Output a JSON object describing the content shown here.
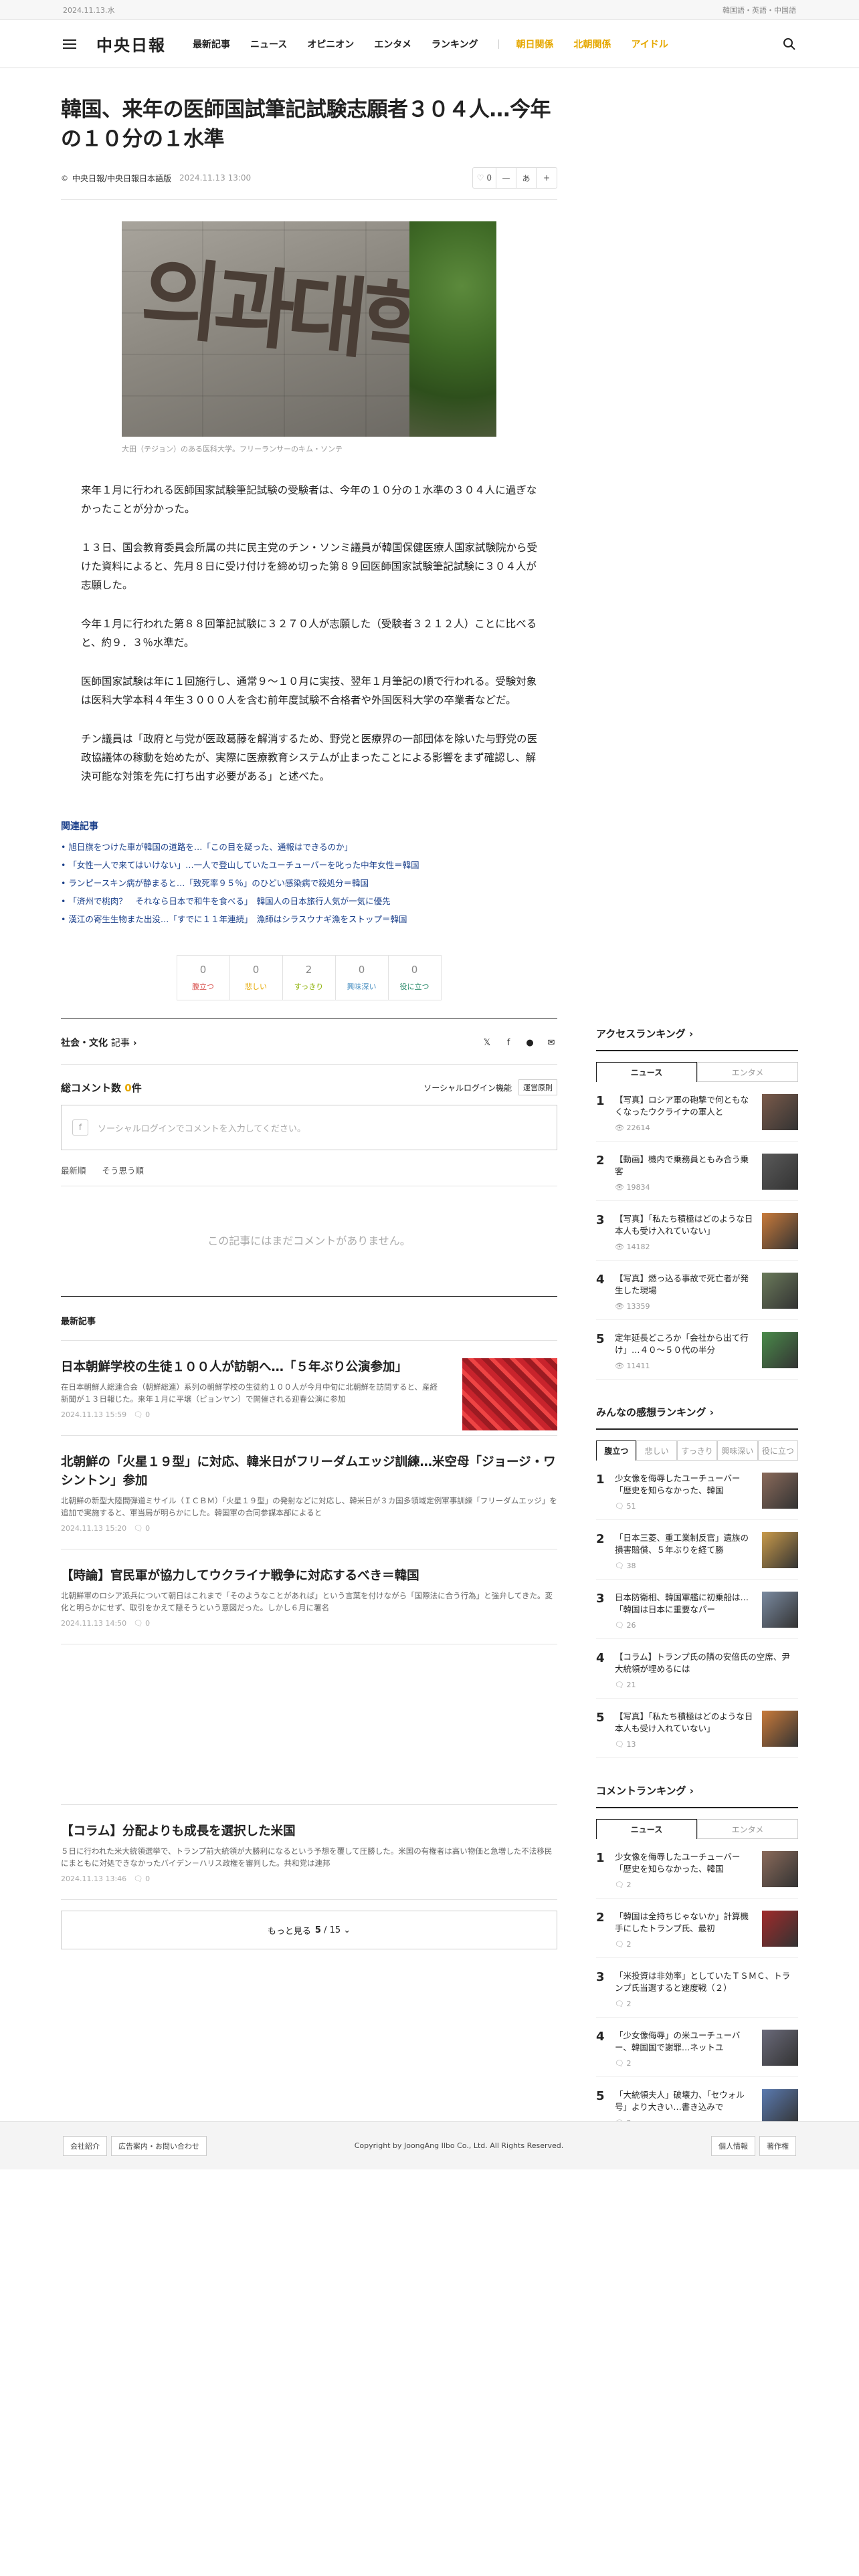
{
  "topbar": {
    "date": "2024.11.13.水",
    "langs": "韓国語・英語・中国語"
  },
  "header": {
    "logo": "中央日報",
    "nav": [
      "最新記事",
      "ニュース",
      "オピニオン",
      "エンタメ",
      "ランキング"
    ],
    "nav_special": [
      "朝日関係",
      "北朝関係",
      "アイドル"
    ]
  },
  "article": {
    "title": "韓国、来年の医師国試筆記試験志願者３０４人…今年の１０分の１水準",
    "source": "中央日報/中央日報日本語版",
    "date": "2024.11.13 13:00",
    "like_count": "0",
    "font_label": "あ",
    "caption": "大田（テジョン）のある医科大学。フリーランサーのキム・ソンテ",
    "paragraphs": [
      "来年１月に行われる医師国家試験筆記試験の受験者は、今年の１０分の１水準の３０４人に過ぎなかったことが分かった。",
      "１３日、国会教育委員会所属の共に民主党のチン・ソンミ議員が韓国保健医療人国家試験院から受けた資料によると、先月８日に受け付けを締め切った第８９回医師国家試験筆記試験に３０４人が志願した。",
      "今年１月に行われた第８８回筆記試験に３２７０人が志願した（受験者３２１２人）ことに比べると、約９．３％水準だ。",
      "医師国家試験は年に１回施行し、通常９～１０月に実技、翌年１月筆記の順で行われる。受験対象は医科大学本科４年生３０００人を含む前年度試験不合格者や外国医科大学の卒業者などだ。",
      "チン議員は「政府と与党が医政葛藤を解消するため、野党と医療界の一部団体を除いた与野党の医政協議体の稼動を始めたが、実際に医療教育システムが止まったことによる影響をまず確認し、解決可能な対策を先に打ち出す必要がある」と述べた。"
    ]
  },
  "related": {
    "title": "関連記事",
    "items": [
      "旭日旗をつけた車が韓国の道路を…「この目を疑った、通報はできるのか」",
      "「女性一人で来てはいけない」…一人で登山していたユーチューバーを叱った中年女性＝韓国",
      "ランピースキン病が静まると…「致死率９５％」のひどい感染病で殺処分＝韓国",
      "「済州で桃肉？　それなら日本で和牛を食べる」　韓国人の日本旅行人気が一気に優先",
      "漢江の寄生生物また出没…「すでに１１年連続」　漁師はシラスウナギ漁をストップ＝韓国"
    ]
  },
  "reactions": [
    {
      "count": "0",
      "label": "腹立つ",
      "color": "#d9534f"
    },
    {
      "count": "0",
      "label": "悲しい",
      "color": "#e6a800"
    },
    {
      "count": "2",
      "label": "すっきり",
      "color": "#8ab000"
    },
    {
      "count": "0",
      "label": "興味深い",
      "color": "#4a90c2"
    },
    {
      "count": "0",
      "label": "役に立つ",
      "color": "#2a8a6a"
    }
  ],
  "category": {
    "name": "社会・文化",
    "suffix": "記事"
  },
  "comments": {
    "title": "総コメント数",
    "count": "0",
    "unit": "件",
    "social_login": "ソーシャルログイン機能",
    "policy": "運営原則",
    "placeholder": "ソーシャルログインでコメントを入力してください。",
    "sort1": "最新順",
    "sort2": "そう思う順",
    "empty": "この記事にはまだコメントがありません。"
  },
  "latest": {
    "title": "最新記事",
    "items": [
      {
        "title": "日本朝鮮学校の生徒１００人が訪朝へ…「５年ぶり公演参加」",
        "desc": "在日本朝鮮人総連合会（朝鮮総連）系列の朝鮮学校の生徒約１００人が今月中旬に北朝鮮を訪問すると、産経新聞が１３日報じた。来年１月に平壌（ピョンヤン）で開催される迎春公演に参加",
        "date": "2024.11.13 15:59",
        "c": "0"
      },
      {
        "title": "北朝鮮の「火星１９型」に対応、韓米日がフリーダムエッジ訓練…米空母「ジョージ・ワシントン」参加",
        "desc": "北朝鮮の新型大陸間弾道ミサイル（ＩＣＢＭ）「火星１９型」の発射などに対応し、韓米日が３カ国多領域定例軍事訓練「フリーダムエッジ」を追加で実施すると、軍当局が明らかにした。韓国軍の合同参謀本部によると",
        "date": "2024.11.13 15:20",
        "c": "0"
      },
      {
        "title": "【時論】官民軍が協力してウクライナ戦争に対応するべき＝韓国",
        "desc": "北朝鮮軍のロシア派兵について朝日はこれまで「そのようなことがあれば」という言葉を付けながら「国際法に合う行為」と強弁してきた。変化と明らかにせず、取引をかえて隠そうという意図だった。しかし６月に署名",
        "date": "2024.11.13 14:50",
        "c": "0"
      },
      {
        "title": "【コラム】分配よりも成長を選択した米国",
        "desc": "５日に行われた米大統領選挙で、トランプ前大統領が大勝利になるという予想を覆して圧勝した。米国の有権者は高い物価と急増した不法移民にまともに対処できなかったバイデン－ハリス政権を審判した。共和党は連邦",
        "date": "2024.11.13 13:46",
        "c": "0"
      }
    ],
    "more_label": "もっと見る",
    "page": "5",
    "total": "15"
  },
  "access_ranking": {
    "title": "アクセスランキング",
    "tabs": [
      "ニュース",
      "エンタメ"
    ],
    "items": [
      {
        "t": "【写真】ロシア軍の砲撃で何ともなくなったウクライナの軍人と",
        "v": "22614",
        "img": "#7a5a4a"
      },
      {
        "t": "【動画】機内で乗務員ともみ合う乗客",
        "v": "19834",
        "img": "#5a5a5a"
      },
      {
        "t": "【写真】「私たち積極はどのような日本人も受け入れていない」",
        "v": "14182",
        "img": "#c87a3a"
      },
      {
        "t": "【写真】燃っ込る事故で死亡者が発生した現場",
        "v": "13359",
        "img": "#6a7a5a"
      },
      {
        "t": "定年延長どころか「会社から出て行け」…４０～５０代の半分",
        "v": "11411",
        "img": "#4a8a4a"
      }
    ]
  },
  "reaction_ranking": {
    "title": "みんなの感想ランキング",
    "tabs": [
      "腹立つ",
      "悲しい",
      "すっきり",
      "興味深い",
      "役に立つ"
    ],
    "items": [
      {
        "t": "少女像を侮辱したユーチューバー「歴史を知らなかった、韓国",
        "v": "51",
        "img": "#8a6a5a"
      },
      {
        "t": "「日本三菱、重工業制反官」遺族の損害賠償、５年ぶりを経て勝",
        "v": "38",
        "img": "#c89a4a"
      },
      {
        "t": "日本防衛相、韓国軍艦に初乗船は…「韓国は日本に重要なパー",
        "v": "26",
        "img": "#7a8aa0"
      },
      {
        "t": "【コラム】トランプ氏の隣の安倍氏の空席、尹大統領が埋めるには",
        "v": "21",
        "img": ""
      },
      {
        "t": "【写真】「私たち積極はどのような日本人も受け入れていない」",
        "v": "13",
        "img": "#c87a3a"
      }
    ]
  },
  "comment_ranking": {
    "title": "コメントランキング",
    "tabs": [
      "ニュース",
      "エンタメ"
    ],
    "items": [
      {
        "t": "少女像を侮辱したユーチューバー「歴史を知らなかった、韓国",
        "v": "2",
        "img": "#8a6a5a"
      },
      {
        "t": "「韓国は全持ちじゃないか」計算機手にしたトランプ氏、最初",
        "v": "2",
        "img": "#a02a2a"
      },
      {
        "t": "「米投資は非効率」としていたＴＳＭＣ、トランプ氏当選すると速度戦（２）",
        "v": "2",
        "img": ""
      },
      {
        "t": "「少女像侮辱」の米ユーチューバー、韓国国で謝罪…ネットユ",
        "v": "2",
        "img": "#6a6a7a"
      },
      {
        "t": "「大統領夫人」破壊力、「セウォル号」より大きい…書き込みで",
        "v": "2",
        "img": "#5a7ab0"
      }
    ]
  },
  "footer": {
    "left": [
      "会社紹介",
      "広告案内・お問い合わせ"
    ],
    "copyright": "Copyright by JoongAng Ilbo Co., Ltd. All Rights Reserved.",
    "right": [
      "個人情報",
      "著作権"
    ]
  }
}
